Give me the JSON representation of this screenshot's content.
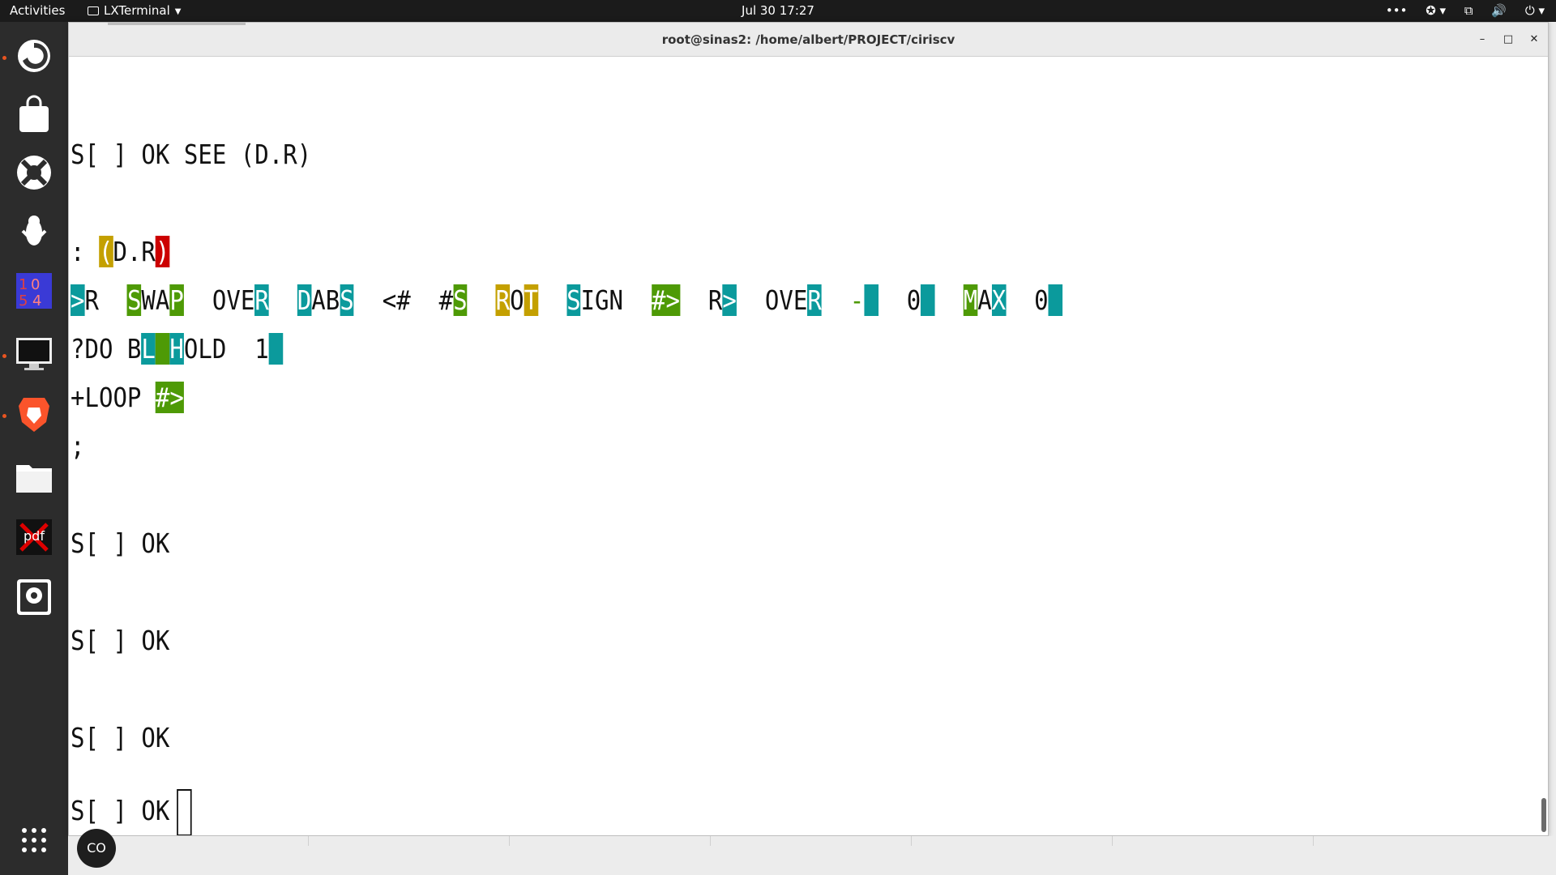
{
  "topbar": {
    "activities": "Activities",
    "app_menu": "LXTerminal",
    "clock": "Jul 30  17:27",
    "tray": {
      "overflow_icon": "ellipsis-icon",
      "accessibility_icon": "accessibility-icon",
      "network_icon": "network-icon",
      "volume_icon": "volume-icon",
      "power_icon": "power-icon"
    }
  },
  "dock": {
    "items": [
      {
        "name": "firefox",
        "icon": "firefox-icon",
        "running": true
      },
      {
        "name": "software",
        "icon": "shopping-bag-icon",
        "running": false
      },
      {
        "name": "help",
        "icon": "lifebuoy-icon",
        "running": false
      },
      {
        "name": "app",
        "icon": "penguin-icon",
        "running": false
      },
      {
        "name": "calculator",
        "icon": "numbers-icon",
        "running": false
      },
      {
        "name": "terminal",
        "icon": "monitor-icon",
        "running": true
      },
      {
        "name": "brave",
        "icon": "brave-lion-icon",
        "running": true
      },
      {
        "name": "files",
        "icon": "folder-icon",
        "running": false
      },
      {
        "name": "pdf",
        "icon": "pdf-icon",
        "running": false
      },
      {
        "name": "disk",
        "icon": "disk-icon",
        "running": false
      },
      {
        "name": "show-apps",
        "icon": "grid-icon",
        "running": false
      }
    ],
    "pdf_label": "pdf"
  },
  "window": {
    "title": "root@sinas2: /home/albert/PROJECT/ciriscv",
    "minimize": "–",
    "maximize": "□",
    "close": "✕"
  },
  "terminal": {
    "line1": "S[ ] OK SEE (D.R)",
    "def_colon": ": ",
    "def_open_paren": "(",
    "def_name_mid": "D.R",
    "def_close_paren": ")",
    "body": {
      "line1": [
        {
          "t": ">",
          "s": "hl-cyan"
        },
        {
          "t": "R  ",
          "s": ""
        },
        {
          "t": "S",
          "s": "hl-green"
        },
        {
          "t": "WA",
          "s": ""
        },
        {
          "t": "P",
          "s": "hl-green"
        },
        {
          "t": "  OVE",
          "s": ""
        },
        {
          "t": "R",
          "s": "hl-cyan"
        },
        {
          "t": "  ",
          "s": ""
        },
        {
          "t": "D",
          "s": "hl-cyan"
        },
        {
          "t": "AB",
          "s": ""
        },
        {
          "t": "S",
          "s": "hl-cyan"
        },
        {
          "t": "  <#  #",
          "s": ""
        },
        {
          "t": "S",
          "s": "hl-green"
        },
        {
          "t": "  ",
          "s": ""
        },
        {
          "t": "R",
          "s": "hl-gold"
        },
        {
          "t": "O",
          "s": ""
        },
        {
          "t": "T",
          "s": "hl-gold"
        },
        {
          "t": "  ",
          "s": ""
        },
        {
          "t": "S",
          "s": "hl-cyan"
        },
        {
          "t": "IGN  ",
          "s": ""
        },
        {
          "t": "#>",
          "s": "hl-green"
        },
        {
          "t": "  R",
          "s": ""
        },
        {
          "t": ">",
          "s": "hl-cyan"
        },
        {
          "t": "  OVE",
          "s": ""
        },
        {
          "t": "R",
          "s": "hl-cyan"
        },
        {
          "t": "  ",
          "s": ""
        },
        {
          "t": "-",
          "s": "hl-greenfg"
        },
        {
          "t": " ",
          "s": "hl-cyan"
        },
        {
          "t": "  0",
          "s": ""
        },
        {
          "t": " ",
          "s": "hl-cyan"
        },
        {
          "t": "  ",
          "s": ""
        },
        {
          "t": "M",
          "s": "hl-green"
        },
        {
          "t": "A",
          "s": ""
        },
        {
          "t": "X",
          "s": "hl-cyan"
        },
        {
          "t": "  0",
          "s": ""
        },
        {
          "t": " ",
          "s": "hl-cyan"
        }
      ],
      "line2": [
        {
          "t": "?DO B",
          "s": ""
        },
        {
          "t": "L",
          "s": "hl-cyan"
        },
        {
          "t": " ",
          "s": "hl-green"
        },
        {
          "t": "H",
          "s": "hl-cyan"
        },
        {
          "t": "OLD  1",
          "s": ""
        },
        {
          "t": " ",
          "s": "hl-cyan"
        }
      ],
      "line3": [
        {
          "t": "+LOOP ",
          "s": ""
        },
        {
          "t": "#>",
          "s": "hl-green"
        }
      ],
      "line4": ";"
    },
    "prompt_ok_1": "S[ ] OK",
    "prompt_ok_2": "S[ ] OK",
    "prompt_ok_3": "S[ ] OK",
    "prompt_ok_4": "S[ ] OK"
  },
  "bottom": {
    "co_button": "CO"
  }
}
